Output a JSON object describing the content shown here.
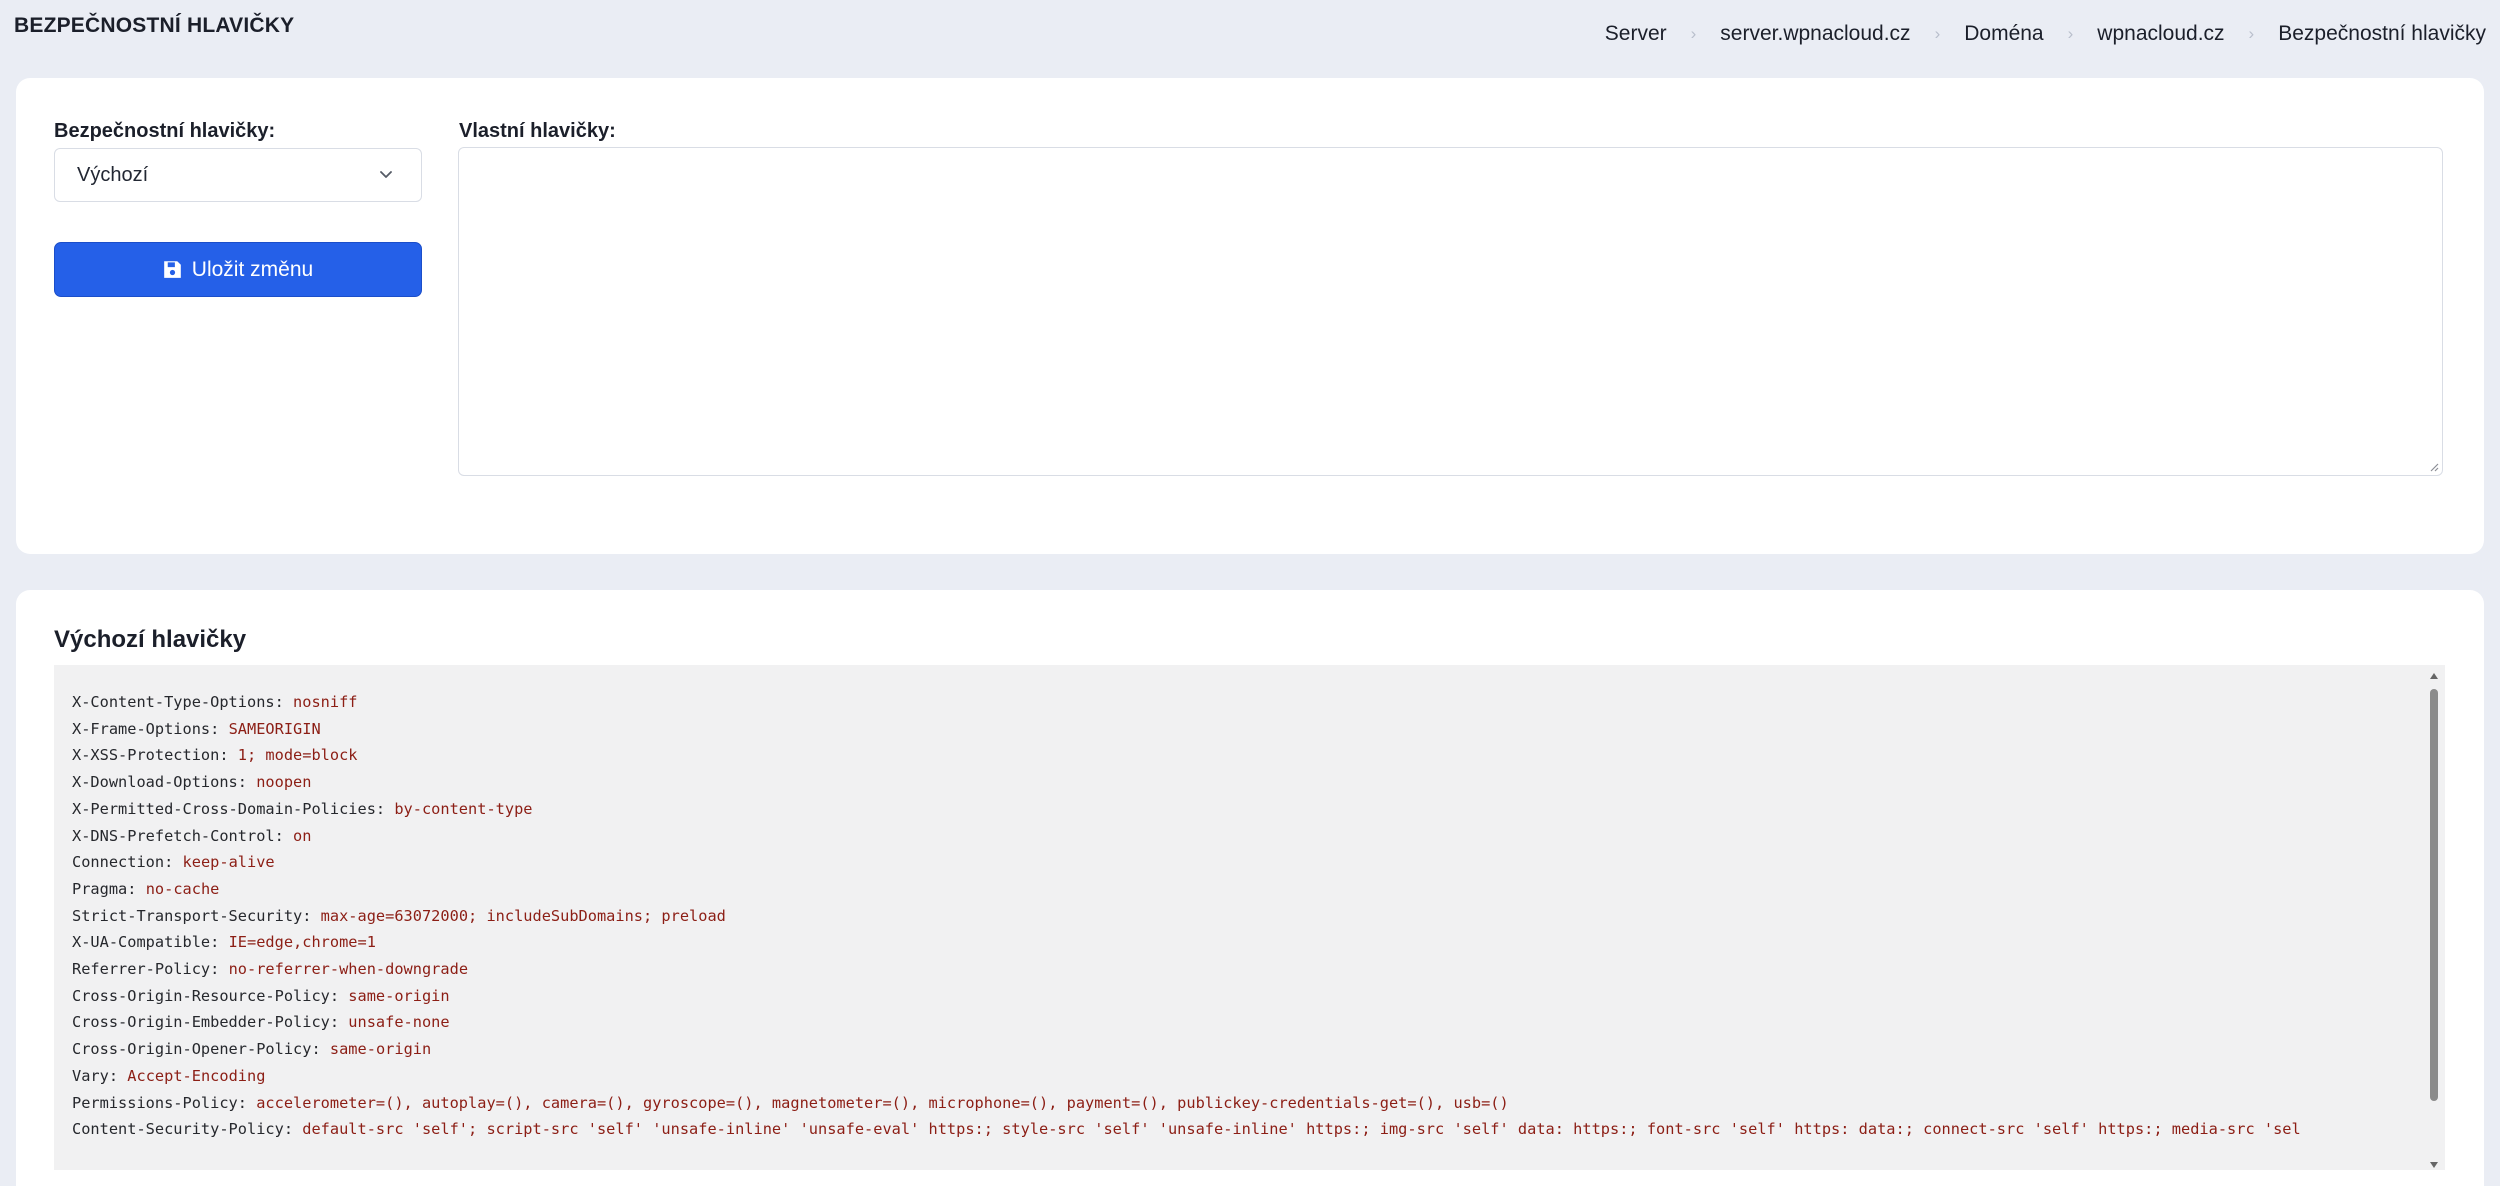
{
  "header": {
    "title": "BEZPEČNOSTNÍ HLAVIČKY",
    "breadcrumb": [
      "Server",
      "server.wpnacloud.cz",
      "Doména",
      "wpnacloud.cz",
      "Bezpečnostní hlavičky"
    ]
  },
  "settings": {
    "security_label": "Bezpečnostní hlavičky:",
    "security_value": "Výchozí",
    "custom_label": "Vlastní hlavičky:",
    "custom_value": "",
    "save_label": "Uložit změnu"
  },
  "defaults": {
    "title": "Výchozí hlavičky",
    "lines": [
      {
        "key": "X-Content-Type-Options:",
        "value": "nosniff"
      },
      {
        "key": "X-Frame-Options:",
        "value": "SAMEORIGIN"
      },
      {
        "key": "X-XSS-Protection:",
        "value": "1; mode=block"
      },
      {
        "key": "X-Download-Options:",
        "value": "noopen"
      },
      {
        "key": "X-Permitted-Cross-Domain-Policies:",
        "value": "by-content-type"
      },
      {
        "key": "X-DNS-Prefetch-Control:",
        "value": "on"
      },
      {
        "key": "Connection:",
        "value": "keep-alive"
      },
      {
        "key": "Pragma:",
        "value": "no-cache"
      },
      {
        "key": "Strict-Transport-Security:",
        "value": "max-age=63072000; includeSubDomains; preload"
      },
      {
        "key": "X-UA-Compatible:",
        "value": "IE=edge,chrome=1"
      },
      {
        "key": "Referrer-Policy:",
        "value": "no-referrer-when-downgrade"
      },
      {
        "key": "Cross-Origin-Resource-Policy:",
        "value": "same-origin"
      },
      {
        "key": "Cross-Origin-Embedder-Policy:",
        "value": "unsafe-none"
      },
      {
        "key": "Cross-Origin-Opener-Policy:",
        "value": "same-origin"
      },
      {
        "key": "Vary:",
        "value": "Accept-Encoding"
      },
      {
        "key": "Permissions-Policy:",
        "value": "accelerometer=(), autoplay=(), camera=(), gyroscope=(), magnetometer=(), microphone=(), payment=(), publickey-credentials-get=(), usb=()"
      },
      {
        "key": "Content-Security-Policy:",
        "value": "default-src 'self'; script-src 'self' 'unsafe-inline' 'unsafe-eval' https:; style-src 'self' 'unsafe-inline' https:; img-src 'self' data: https:; font-src 'self' https: data:; connect-src 'self' https:; media-src 'sel"
      }
    ]
  },
  "colors": {
    "primary": "#2560e8",
    "background": "#eaedf4",
    "code_value": "#8c1e15"
  },
  "icons": {
    "breadcrumb_separator": "chevron-right-icon",
    "select": "chevron-down-icon",
    "save": "floppy-disk-icon"
  }
}
